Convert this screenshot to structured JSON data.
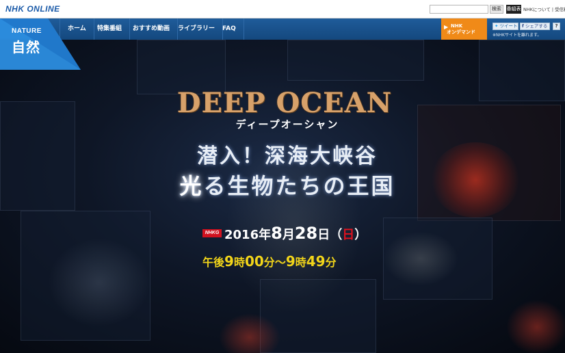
{
  "header": {
    "logo": "NHK ONLINE",
    "search_placeholder": "",
    "search_button": "検索",
    "program_button": "番組表",
    "about_link": "NHKについて | 受信料"
  },
  "nav": {
    "items": [
      "ホーム",
      "特集番組",
      "おすすめ動画",
      "ライブラリー",
      "FAQ"
    ],
    "ondemand_top": "NHK",
    "ondemand_bottom": "オンデマンド",
    "tweet": "ツイート",
    "share": "シェアする",
    "help": "?",
    "leave_note": "※NHKサイトを離れます。"
  },
  "badge": {
    "word": "NATURE",
    "kanji": "自然"
  },
  "hero": {
    "title_en": "DEEP OCEAN",
    "title_kana": "ディープオーシャン",
    "tagline1": "潜入！深海大峡谷",
    "tagline2_hi": "光",
    "tagline2_rest": "る生物たちの王国",
    "channel": "NHKG",
    "date_year": "2016年",
    "date_month": "8",
    "date_month_unit": "月",
    "date_day": "28",
    "date_day_unit": "日",
    "date_weekday_open": "（",
    "date_weekday": "日",
    "date_weekday_close": "）",
    "time_prefix": "午後",
    "time_start_h": "9",
    "time_start_h_unit": "時",
    "time_start_m": "00",
    "time_start_m_unit": "分",
    "time_sep": "～",
    "time_end_h": "9",
    "time_end_h_unit": "時",
    "time_end_m": "49",
    "time_end_m_unit": "分"
  },
  "colors": {
    "nav_blue": "#14487e",
    "ondemand_orange": "#f08a18",
    "title_gold": "#d7a16a",
    "time_yellow": "#f2d51a",
    "sunday_red": "#e0121f"
  }
}
